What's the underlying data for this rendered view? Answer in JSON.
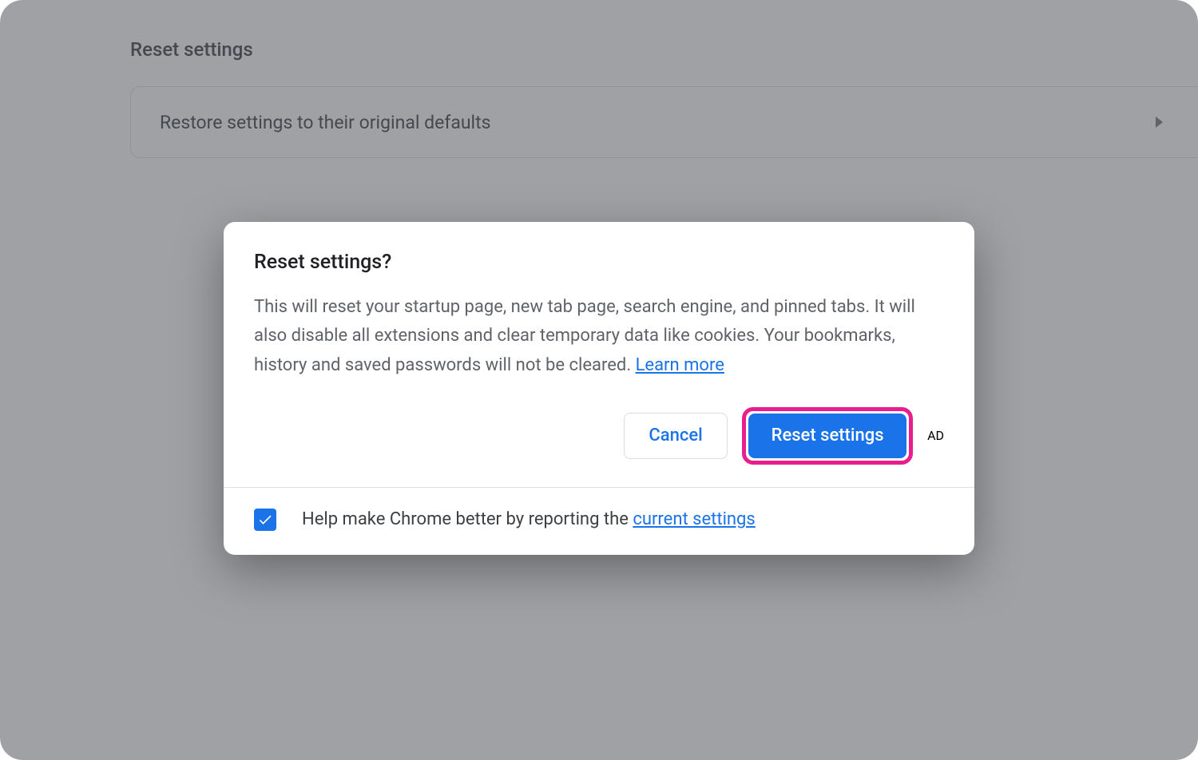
{
  "page": {
    "section_title": "Reset settings",
    "restore_row_label": "Restore settings to their original defaults"
  },
  "dialog": {
    "title": "Reset settings?",
    "body_text": "This will reset your startup page, new tab page, search engine, and pinned tabs. It will also disable all extensions and clear temporary data like cookies. Your bookmarks, history and saved passwords will not be cleared. ",
    "learn_more": "Learn more",
    "cancel_label": "Cancel",
    "confirm_label": "Reset settings",
    "footer_prefix": "Help make Chrome better by reporting the ",
    "footer_link": "current settings",
    "checkbox_checked": true
  },
  "colors": {
    "accent": "#1a73e8",
    "highlight": "#e91e8c"
  }
}
